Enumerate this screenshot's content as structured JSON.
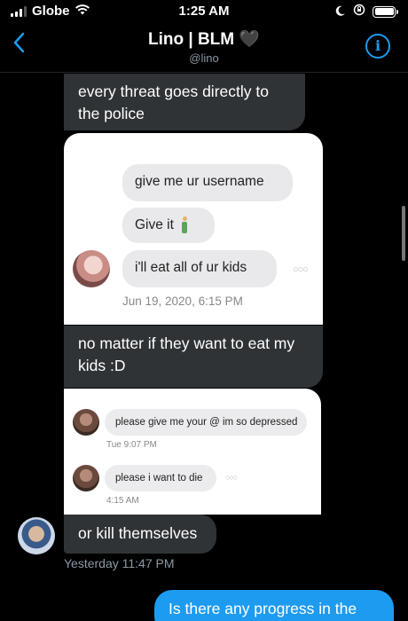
{
  "status_bar": {
    "carrier": "Globe",
    "time": "1:25 AM"
  },
  "header": {
    "back_icon": "chevron-left-icon",
    "name": "Lino | BLM 🖤",
    "handle": "@lino",
    "info_icon": "info-icon"
  },
  "messages": {
    "m1": "every threat goes directly to the police",
    "shot1": {
      "b1": "give me ur username",
      "b2": "Give it",
      "b3": "i'll eat all of ur kids",
      "timestamp": "Jun 19, 2020, 6:15 PM"
    },
    "m2": "no matter if they want to eat my kids :D",
    "shot2": {
      "b1": "please give me your @ im so depressed",
      "ts1": "Tue 9:07 PM",
      "b2": "please i want to die",
      "ts2": "4:15 AM"
    },
    "m3": "or kill themselves",
    "timestamp": "Yesterday 11:47 PM",
    "outgoing": "Is there any progress in the"
  },
  "colors": {
    "accent": "#1d9bf0",
    "bubble_dark": "#2f3336",
    "background": "#000000"
  }
}
